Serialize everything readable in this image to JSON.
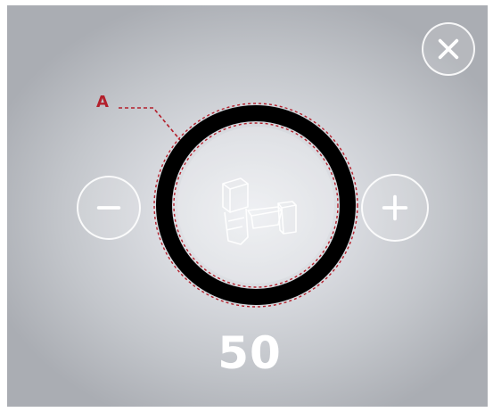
{
  "annotation": {
    "label": "A",
    "color": "#b3202c"
  },
  "dial": {
    "ring_color": "#000000",
    "center_icon": "power-tool-icon"
  },
  "value": {
    "text": "50"
  },
  "buttons": {
    "close_icon": "close-icon",
    "minus_icon": "minus-icon",
    "plus_icon": "plus-icon"
  }
}
